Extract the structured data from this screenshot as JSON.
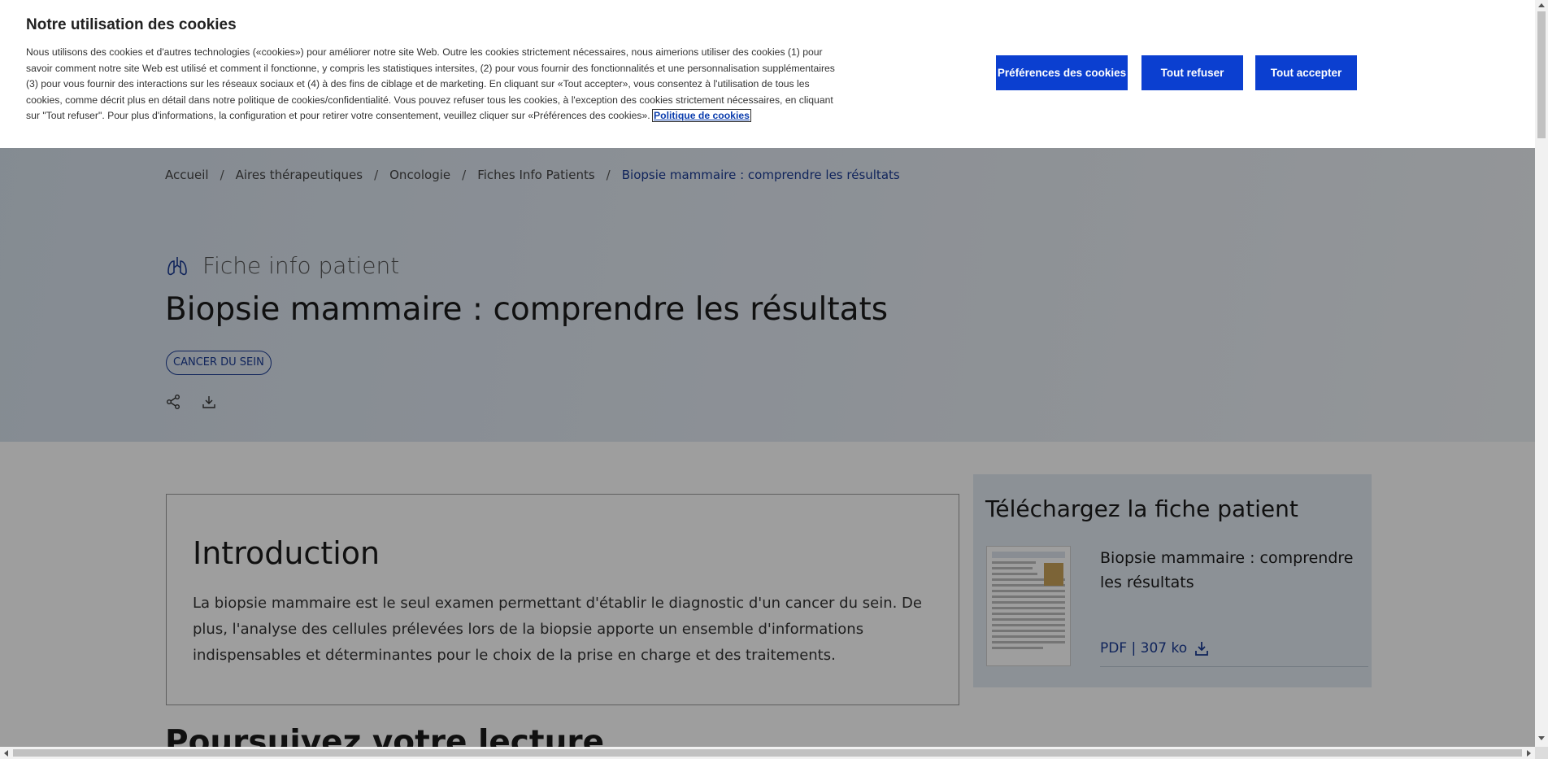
{
  "cookie_banner": {
    "title": "Notre utilisation des cookies",
    "body": "Nous utilisons des cookies et d'autres technologies («cookies») pour améliorer notre site Web. Outre les cookies strictement nécessaires, nous aimerions utiliser des cookies (1) pour savoir comment notre site Web est utilisé et comment il fonctionne, y compris les statistiques intersites, (2) pour vous fournir des fonctionnalités et une personnalisation supplémentaires (3) pour vous fournir des interactions sur les réseaux sociaux et (4) à des fins de ciblage et de marketing. En cliquant sur «Tout accepter», vous consentez à l'utilisation de tous les cookies, comme décrit plus en détail dans notre politique de cookies/confidentialité. Vous pouvez refuser tous les cookies, à l'exception des cookies strictement nécessaires, en cliquant sur \"Tout refuser\". Pour plus d'informations, la configuration et pour retirer votre consentement, veuillez cliquer sur «Préférences des cookies». ",
    "policy_link": "Politique de cookies",
    "btn_preferences": "Préférences des cookies",
    "btn_refuse": "Tout refuser",
    "btn_accept": "Tout accepter",
    "button_color": "#0b3fd0"
  },
  "breadcrumb": {
    "items": [
      "Accueil",
      "Aires thérapeutiques",
      "Oncologie",
      "Fiches Info Patients"
    ],
    "separator": "/",
    "current": "Biopsie mammaire : comprendre les résultats"
  },
  "hero": {
    "kicker_icon": "lungs-icon",
    "kicker": "Fiche info patient",
    "title": "Biopsie mammaire : comprendre les résultats",
    "tag": "CANCER DU SEIN",
    "share_icon": "share-icon",
    "download_icon": "download-icon"
  },
  "intro": {
    "heading": "Introduction",
    "text": "La biopsie mammaire est le seul examen permettant d'établir le diagnostic d'un cancer du sein. De plus, l'analyse des cellules prélevées lors de la biopsie apporte un ensemble d'informations indispensables et déterminantes pour le choix de la prise en charge et des traitements."
  },
  "download": {
    "heading": "Téléchargez la fiche patient",
    "doc_title": "Biopsie mammaire : comprendre les résultats",
    "meta": "PDF | 307 ko"
  },
  "next_heading": "Poursuivez votre lecture"
}
